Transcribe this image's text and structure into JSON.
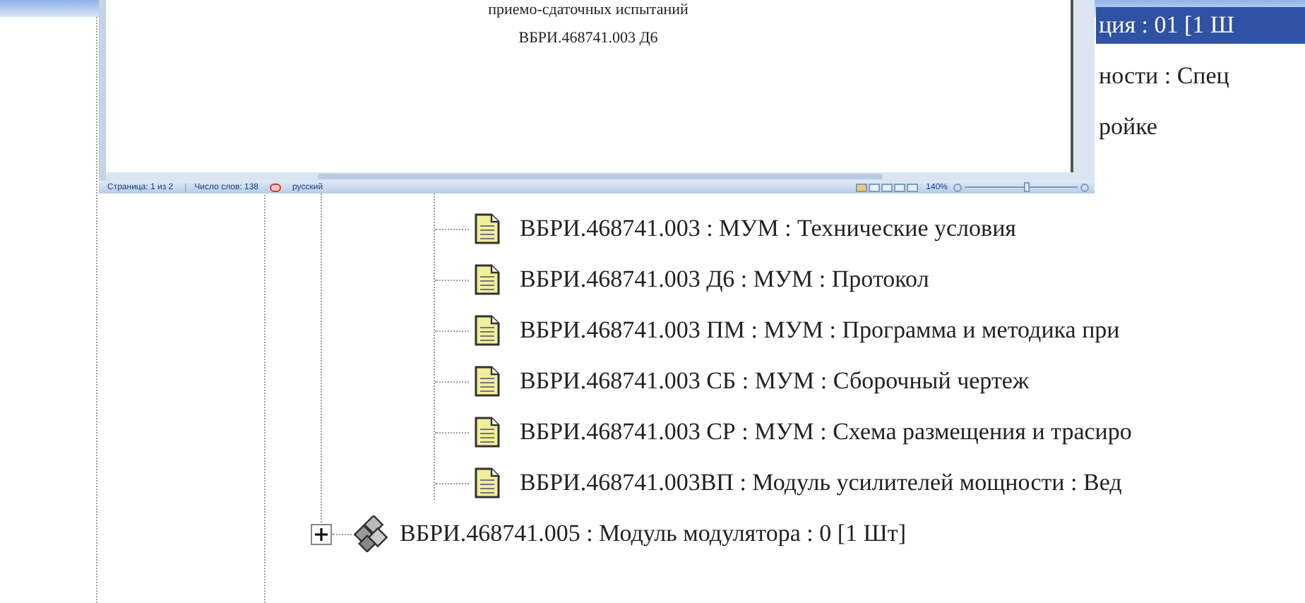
{
  "document_window": {
    "page_lines": [
      "приемо-сдаточных испытаний",
      "ВБРИ.468741.003 Д6"
    ],
    "status_bar": {
      "page": "Страница: 1 из 2",
      "words": "Число слов: 138",
      "language": "русский",
      "zoom": "140%",
      "zoom_slider": {
        "level": 0.55
      }
    }
  },
  "tree": {
    "partial_rows": [
      {
        "label": "ция : 01 [1 Ш",
        "selected": true
      },
      {
        "label": "ности : Спец",
        "selected": false
      },
      {
        "label": "ройке",
        "selected": false
      }
    ],
    "documents": [
      {
        "label": "ВБРИ.468741.003 : МУМ : Технические условия",
        "selected": false
      },
      {
        "label": "ВБРИ.468741.003 Д6 : МУМ : Протокол",
        "selected": false
      },
      {
        "label": "ВБРИ.468741.003 ПМ : МУМ : Программа и методика при",
        "selected": false
      },
      {
        "label": "ВБРИ.468741.003 СБ : МУМ : Сборочный чертеж",
        "selected": false
      },
      {
        "label": "ВБРИ.468741.003 СР : МУМ : Схема размещения и трасиро",
        "selected": false
      },
      {
        "label": "ВБРИ.468741.003ВП : Модуль усилителей мощности : Вед",
        "selected": false
      }
    ],
    "assemblies": [
      {
        "label": "ВБРИ.468741.005 : Модуль модулятора : 0 [1 Шт]",
        "expanded": false,
        "selected": false
      }
    ]
  }
}
